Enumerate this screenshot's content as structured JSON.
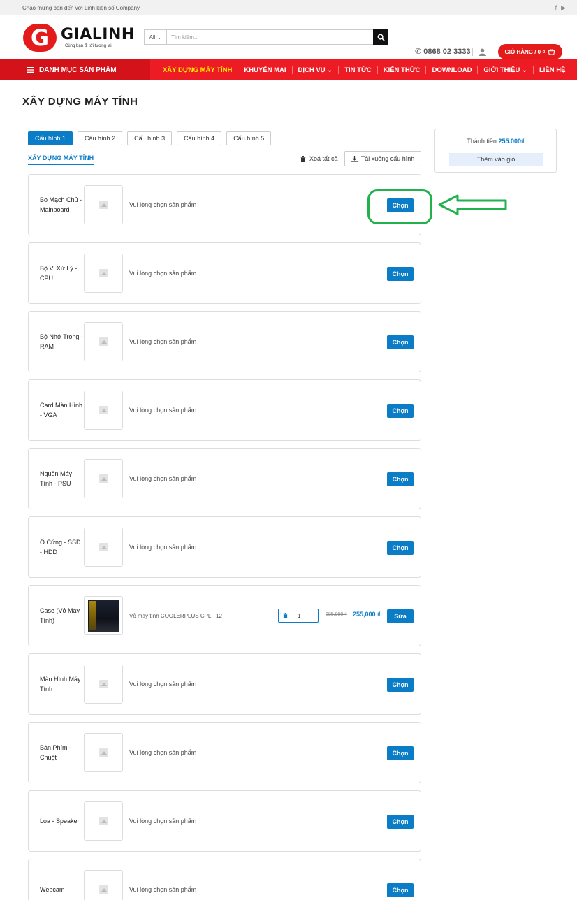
{
  "topbar": {
    "welcome": "Chào mừng bạn đến với Linh kiện số Company",
    "facebook": "f",
    "youtube": "▶"
  },
  "header": {
    "logo_mark": "G",
    "logo_name": "GIALINH",
    "logo_slogan": "Cùng bạn đi tới tương lai!",
    "search_category": "All ⌄",
    "search_placeholder": "Tìm kiếm...",
    "phone": "0868 02 3333",
    "cart_label": "GIỎ HÀNG / 0 ₫"
  },
  "nav": {
    "category_menu": "DANH MỤC SẢN PHẨM",
    "links": [
      "XÂY DỰNG MÁY TÍNH",
      "KHUYẾN MẠI",
      "DỊCH VỤ ⌄",
      "TIN TỨC",
      "KIẾN THỨC",
      "DOWNLOAD",
      "GIỚI THIỆU ⌄",
      "LIÊN HỆ"
    ]
  },
  "page": {
    "title": "XÂY DỰNG MÁY TÍNH",
    "tabs": [
      "Cấu hình 1",
      "Cấu hình 2",
      "Cấu hình 3",
      "Cấu hình 4",
      "Cấu hình 5"
    ],
    "sub_title": "XÂY DỰNG MÁY TÍNH",
    "clear_all": "Xoá tất cả",
    "download": "Tải xuống cấu hình"
  },
  "summary": {
    "total_label": "Thành tiền",
    "total_value": "255.000₫",
    "add_to_cart": "Thêm vào giỏ"
  },
  "rows": [
    {
      "label": "Bo Mạch Chủ - Mainboard",
      "hint": "Vui lòng chọn sản phẩm",
      "action": "Chọn"
    },
    {
      "label": "Bộ Vi Xử Lý - CPU",
      "hint": "Vui lòng chọn sản phẩm",
      "action": "Chọn"
    },
    {
      "label": "Bộ Nhớ Trong - RAM",
      "hint": "Vui lòng chọn sản phẩm",
      "action": "Chọn"
    },
    {
      "label": "Card Màn Hình - VGA",
      "hint": "Vui lòng chọn sản phẩm",
      "action": "Chọn"
    },
    {
      "label": "Nguồn Máy Tính - PSU",
      "hint": "Vui lòng chọn sản phẩm",
      "action": "Chọn"
    },
    {
      "label": "Ổ Cứng - SSD - HDD",
      "hint": "Vui lòng chọn sản phẩm",
      "action": "Chọn"
    },
    {
      "label": "Case (Vỏ Máy Tính)",
      "hint": "Vỏ máy tính COOLERPLUS CPL T12",
      "action": "Sửa",
      "qty": "1",
      "old_price": "285,000 ₫",
      "new_price": "255,000 ₫"
    },
    {
      "label": "Màn Hình Máy Tính",
      "hint": "Vui lòng chọn sản phẩm",
      "action": "Chọn"
    },
    {
      "label": "Bàn Phím - Chuột",
      "hint": "Vui lòng chọn sản phẩm",
      "action": "Chọn"
    },
    {
      "label": "Loa - Speaker",
      "hint": "Vui lòng chọn sản phẩm",
      "action": "Chọn"
    },
    {
      "label": "Webcam",
      "hint": "Vui lòng chọn sản phẩm",
      "action": "Chọn"
    }
  ],
  "colors": {
    "brand_red": "#ed1c24",
    "accent_blue": "#0b7cc6",
    "annotation_green": "#22b14c"
  }
}
